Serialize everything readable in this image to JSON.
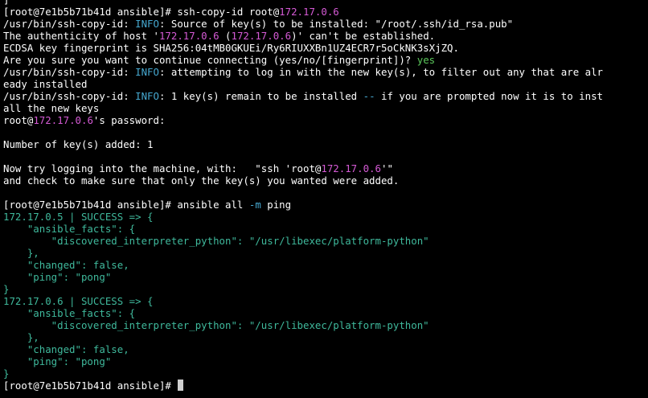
{
  "colors": {
    "background": "#000000",
    "default": "#ffffff",
    "magenta": "#d55ad5",
    "cyan": "#46a8d0",
    "green": "#5cc75c",
    "teal": "#3fb99c",
    "cursor": "#cfcfcf"
  },
  "terminal": {
    "lines": [
      [
        {
          "text": "]",
          "color": "default"
        }
      ],
      [
        {
          "text": "[root@7e1b5b71b41d ansible]# ssh-copy-id root@",
          "color": "default"
        },
        {
          "text": "172.17.0.6",
          "color": "magenta"
        }
      ],
      [
        {
          "text": "/usr/bin/ssh-copy-id: ",
          "color": "default"
        },
        {
          "text": "INFO",
          "color": "cyan"
        },
        {
          "text": ": Source of key(s) to be installed: \"/root/.ssh/id_rsa.pub\"",
          "color": "default"
        }
      ],
      [
        {
          "text": "The authenticity of host '",
          "color": "default"
        },
        {
          "text": "172.17.0.6",
          "color": "magenta"
        },
        {
          "text": " (",
          "color": "default"
        },
        {
          "text": "172.17.0.6",
          "color": "magenta"
        },
        {
          "text": ")' can't be established.",
          "color": "default"
        }
      ],
      [
        {
          "text": "ECDSA key fingerprint is SHA256:04tMB0GKUEi/Ry6RIUXXBn1UZ4ECR7r5oCkNK3sXjZQ.",
          "color": "default"
        }
      ],
      [
        {
          "text": "Are you sure you want to continue connecting (yes/no/[fingerprint])? ",
          "color": "default"
        },
        {
          "text": "yes",
          "color": "green"
        }
      ],
      [
        {
          "text": "/usr/bin/ssh-copy-id: ",
          "color": "default"
        },
        {
          "text": "INFO",
          "color": "cyan"
        },
        {
          "text": ": attempting to log in with the new key(s), to filter out any that are alr",
          "color": "default"
        }
      ],
      [
        {
          "text": "eady installed",
          "color": "default"
        }
      ],
      [
        {
          "text": "/usr/bin/ssh-copy-id: ",
          "color": "default"
        },
        {
          "text": "INFO",
          "color": "cyan"
        },
        {
          "text": ": 1 key(s) remain to be installed ",
          "color": "default"
        },
        {
          "text": "--",
          "color": "cyan"
        },
        {
          "text": " if you are prompted now it is to inst",
          "color": "default"
        }
      ],
      [
        {
          "text": "all the new keys",
          "color": "default"
        }
      ],
      [
        {
          "text": "root@",
          "color": "default"
        },
        {
          "text": "172.17.0.6",
          "color": "magenta"
        },
        {
          "text": "'s password:",
          "color": "default"
        }
      ],
      [],
      [
        {
          "text": "Number of key(s) added: 1",
          "color": "default"
        }
      ],
      [],
      [
        {
          "text": "Now try logging into the machine, with:   \"ssh 'root@",
          "color": "default"
        },
        {
          "text": "172.17.0.6",
          "color": "magenta"
        },
        {
          "text": "'\"",
          "color": "default"
        }
      ],
      [
        {
          "text": "and check to make sure that only the key(s) you wanted were added.",
          "color": "default"
        }
      ],
      [],
      [
        {
          "text": "[root@7e1b5b71b41d ansible]# ansible all ",
          "color": "default"
        },
        {
          "text": "-m",
          "color": "cyan"
        },
        {
          "text": " ping",
          "color": "default"
        }
      ],
      [
        {
          "text": "172.17.0.5 | SUCCESS => {",
          "color": "teal"
        }
      ],
      [
        {
          "text": "    \"ansible_facts\": {",
          "color": "teal"
        }
      ],
      [
        {
          "text": "        \"discovered_interpreter_python\": \"/usr/libexec/platform-python\"",
          "color": "teal"
        }
      ],
      [
        {
          "text": "    },",
          "color": "teal"
        }
      ],
      [
        {
          "text": "    \"changed\": false,",
          "color": "teal"
        }
      ],
      [
        {
          "text": "    \"ping\": \"pong\"",
          "color": "teal"
        }
      ],
      [
        {
          "text": "}",
          "color": "teal"
        }
      ],
      [
        {
          "text": "172.17.0.6 | SUCCESS => {",
          "color": "teal"
        }
      ],
      [
        {
          "text": "    \"ansible_facts\": {",
          "color": "teal"
        }
      ],
      [
        {
          "text": "        \"discovered_interpreter_python\": \"/usr/libexec/platform-python\"",
          "color": "teal"
        }
      ],
      [
        {
          "text": "    },",
          "color": "teal"
        }
      ],
      [
        {
          "text": "    \"changed\": false,",
          "color": "teal"
        }
      ],
      [
        {
          "text": "    \"ping\": \"pong\"",
          "color": "teal"
        }
      ],
      [
        {
          "text": "}",
          "color": "teal"
        }
      ],
      [
        {
          "text": "[root@7e1b5b71b41d ansible]# ",
          "color": "default"
        }
      ]
    ]
  }
}
